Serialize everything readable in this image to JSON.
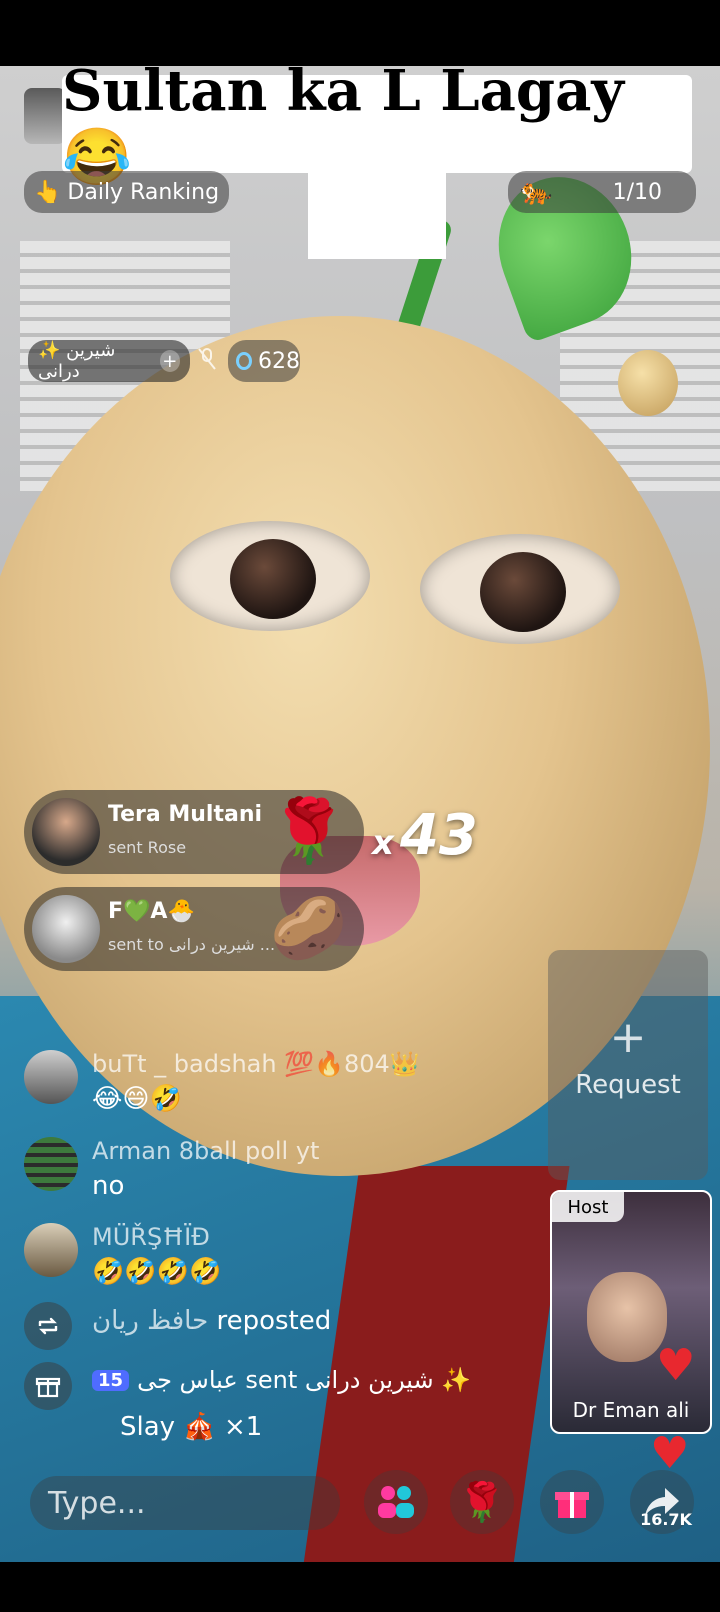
{
  "banner": {
    "title": "Sultan ka L Lagay😂",
    "emoji": "😂"
  },
  "top": {
    "daily_ranking": "Daily Ranking",
    "daily_icon": "👆",
    "rank": "1/10",
    "rank_icon": "🐅"
  },
  "host_chip": {
    "name": "✨ شیرین درانی",
    "plus": "+",
    "coins": "628"
  },
  "gifts": [
    {
      "name": "Tera Multani",
      "sub": "sent Rose",
      "item": "🌹"
    },
    {
      "name": "F💚A🐣",
      "sub": "sent to شیرین درانی ...",
      "item": "🥔"
    }
  ],
  "combo": {
    "x": "x",
    "count": "43"
  },
  "chat": [
    {
      "user": "buTt _ badshah 💯🔥804👑",
      "message": "😂😄🤣"
    },
    {
      "user": "Arman 8ball poll yt",
      "message": "no"
    },
    {
      "user": "MÜŘŞĦÏĐ",
      "message": "🤣🤣🤣🤣"
    }
  ],
  "system": {
    "repost_user": "حافظ ریان",
    "repost_text": "reposted",
    "gift_badge": "15",
    "gift_line": "عباس جی sent شیرین درانی ✨",
    "gift_item": "Slay 🎪 ×1"
  },
  "request": {
    "plus": "+",
    "label": "Request"
  },
  "hostcard": {
    "tag": "Host",
    "name": "Dr Eman ali"
  },
  "bottom": {
    "placeholder": "Type...",
    "share_count": "16.7K"
  },
  "icons": {
    "repost": "repost-icon",
    "gift": "gift-box-icon",
    "share": "share-arrow-icon"
  },
  "colors": {
    "heart": "#e8282f",
    "badge": "#4f6cff"
  }
}
